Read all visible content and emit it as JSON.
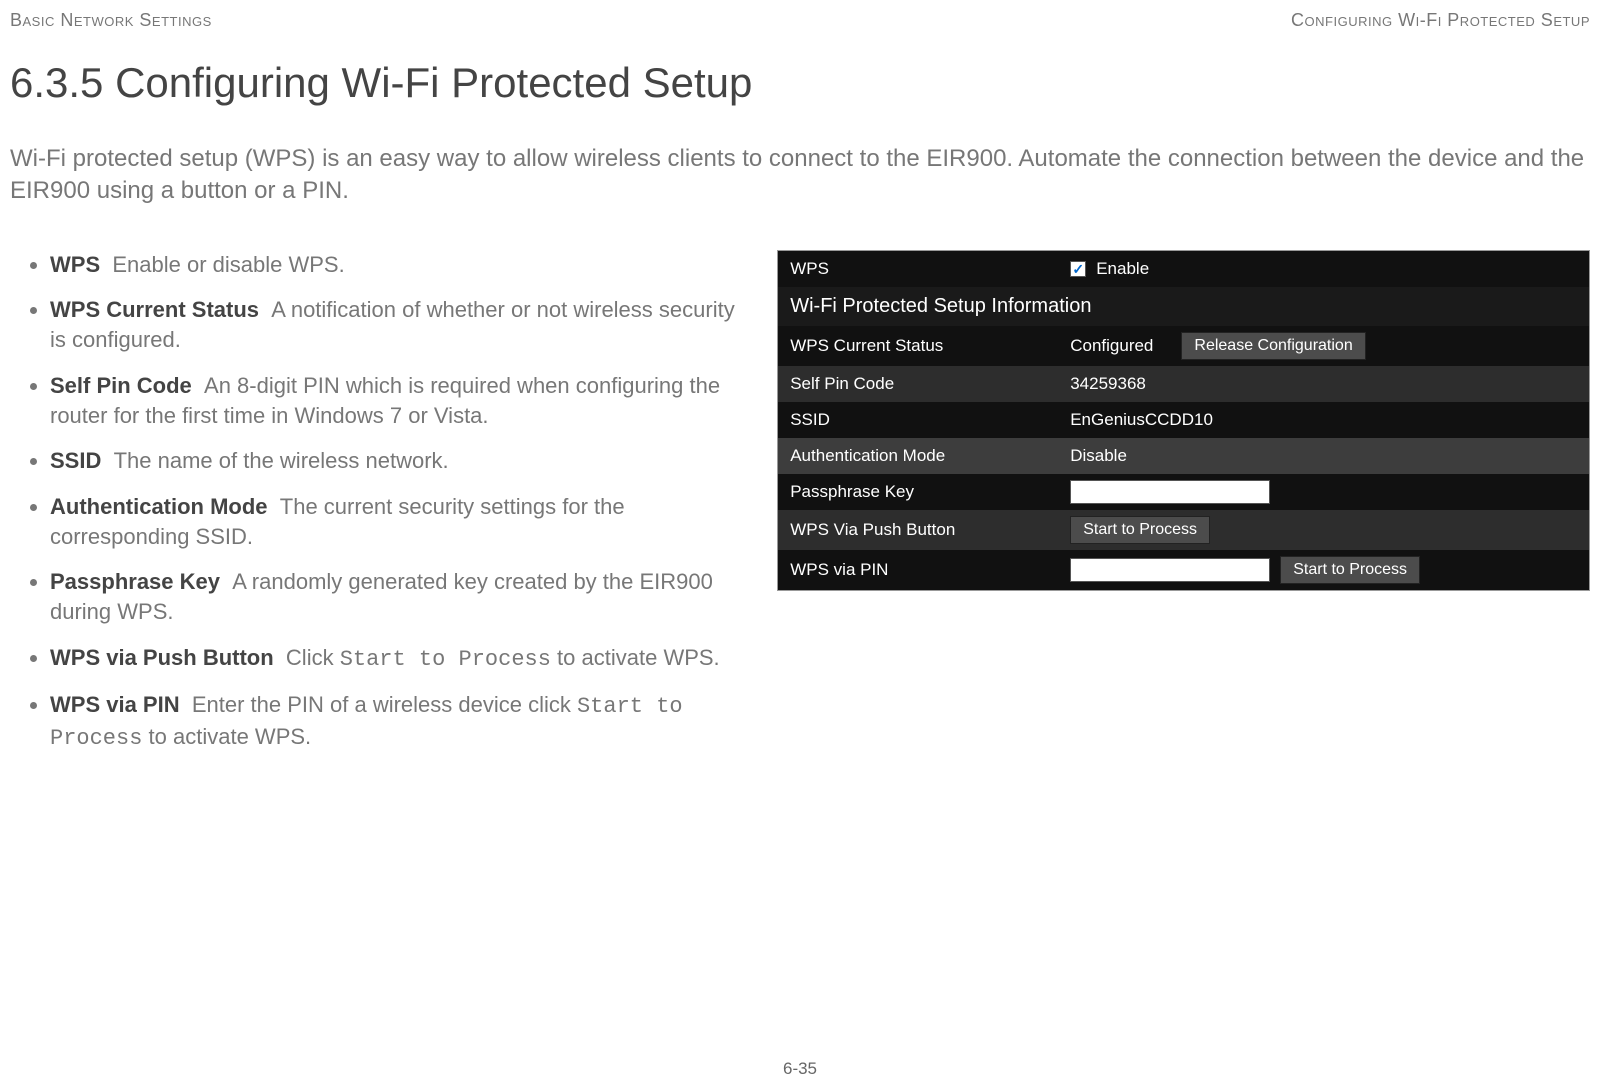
{
  "header": {
    "left": "Basic Network Settings",
    "right": "Configuring Wi-Fi Protected Setup"
  },
  "title": "6.3.5 Configuring Wi-Fi Protected Setup",
  "intro": "Wi-Fi protected setup (WPS) is an easy way to allow wireless clients to connect to the EIR900. Automate the connection between the device and the EIR900 using a button or a PIN.",
  "bullets": [
    {
      "term": "WPS",
      "desc": "Enable or disable WPS."
    },
    {
      "term": "WPS Current Status",
      "desc": "A notification of whether or not wireless security is configured."
    },
    {
      "term": "Self Pin Code",
      "desc": "An 8-digit PIN which is required when configuring the router for the first time in Windows 7 or Vista."
    },
    {
      "term": "SSID",
      "desc": "The name of the wireless network."
    },
    {
      "term": "Authentication Mode",
      "desc": "The current security settings for the corresponding SSID."
    },
    {
      "term": "Passphrase Key",
      "desc": "A randomly generated key created by the EIR900 during WPS."
    },
    {
      "term": "WPS via Push Button",
      "desc_pre": "Click ",
      "code": "Start to Process",
      "desc_post": " to activate WPS."
    },
    {
      "term": "WPS via PIN",
      "desc_pre": "Enter the PIN of a wireless device click ",
      "code": "Start to Process",
      "desc_post": " to activate WPS."
    }
  ],
  "panel": {
    "wps_label": "WPS",
    "enable_label": "Enable",
    "enable_checked": true,
    "section_header": "Wi-Fi Protected Setup Information",
    "rows": {
      "current_status": {
        "label": "WPS Current Status",
        "value": "Configured",
        "button": "Release Configuration"
      },
      "self_pin": {
        "label": "Self Pin Code",
        "value": "34259368"
      },
      "ssid": {
        "label": "SSID",
        "value": "EnGeniusCCDD10"
      },
      "auth_mode": {
        "label": "Authentication Mode",
        "value": "Disable"
      },
      "passphrase": {
        "label": "Passphrase Key",
        "value": ""
      },
      "push_button": {
        "label": "WPS Via Push Button",
        "button": "Start to Process"
      },
      "via_pin": {
        "label": "WPS via PIN",
        "value": "",
        "button": "Start to Process"
      }
    }
  },
  "footer": "6-35"
}
